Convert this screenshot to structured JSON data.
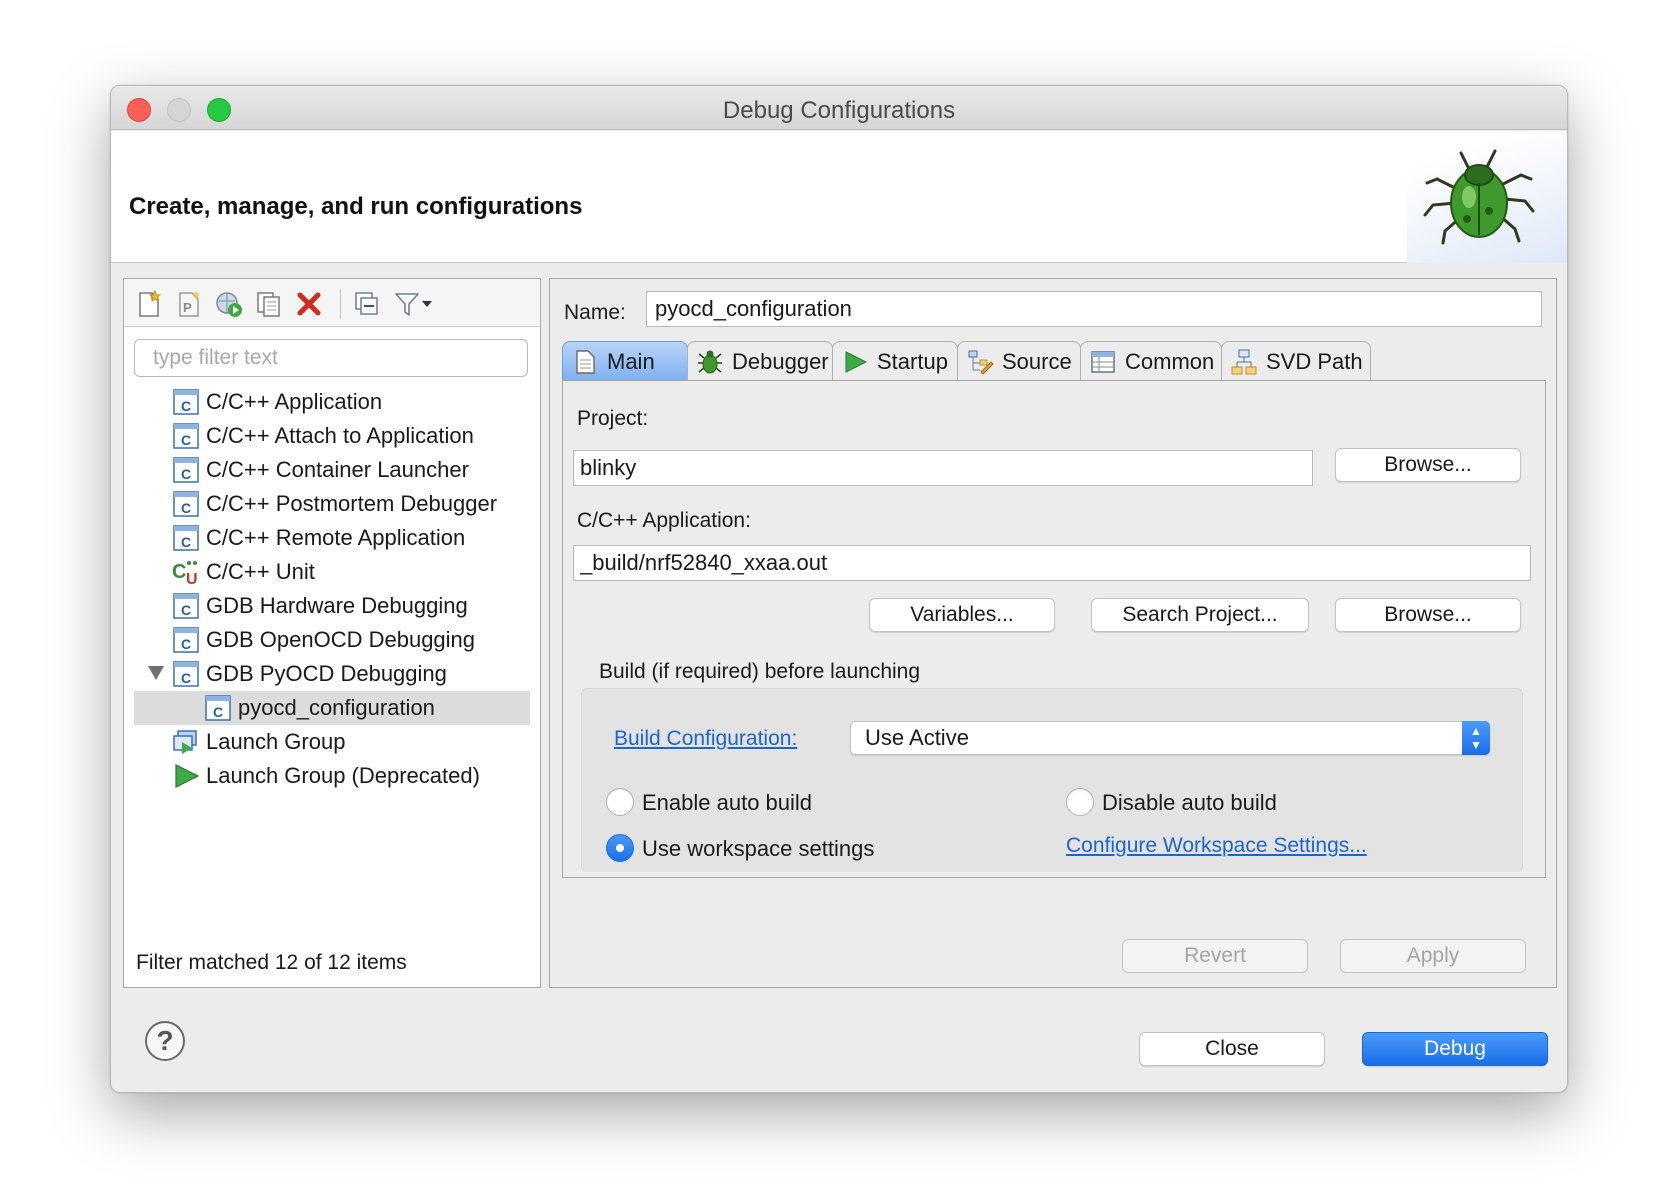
{
  "window": {
    "title": "Debug Configurations"
  },
  "banner": {
    "title": "Create, manage, and run configurations"
  },
  "left": {
    "filter_placeholder": "type filter text",
    "items": [
      {
        "label": "C/C++ Application"
      },
      {
        "label": "C/C++ Attach to Application"
      },
      {
        "label": "C/C++ Container Launcher"
      },
      {
        "label": "C/C++ Postmortem Debugger"
      },
      {
        "label": "C/C++ Remote Application"
      },
      {
        "label": "C/C++ Unit"
      },
      {
        "label": "GDB Hardware Debugging"
      },
      {
        "label": "GDB OpenOCD Debugging"
      },
      {
        "label": "GDB PyOCD Debugging"
      },
      {
        "label": "pyocd_configuration"
      },
      {
        "label": "Launch Group"
      },
      {
        "label": "Launch Group (Deprecated)"
      }
    ],
    "status": "Filter matched 12 of 12 items"
  },
  "right": {
    "name_label": "Name:",
    "name_value": "pyocd_configuration",
    "tabs": [
      {
        "label": "Main"
      },
      {
        "label": "Debugger"
      },
      {
        "label": "Startup"
      },
      {
        "label": "Source"
      },
      {
        "label": "Common"
      },
      {
        "label": "SVD Path"
      }
    ],
    "main": {
      "project_label": "Project:",
      "project_value": "blinky",
      "browse1": "Browse...",
      "app_label": "C/C++ Application:",
      "app_value": "_build/nrf52840_xxaa.out",
      "variables": "Variables...",
      "search_project": "Search Project...",
      "browse2": "Browse...",
      "build_group_label": "Build (if required) before launching",
      "build_config_link": "Build Configuration:",
      "build_config_value": "Use Active",
      "enable_auto": "Enable auto build",
      "disable_auto": "Disable auto build",
      "use_workspace": "Use workspace settings",
      "configure_link": "Configure Workspace Settings..."
    },
    "revert": "Revert",
    "apply": "Apply"
  },
  "footer": {
    "help": "?",
    "close": "Close",
    "debug": "Debug"
  },
  "colors": {
    "accent": "#1a6fe8",
    "link": "#1a65cf"
  }
}
